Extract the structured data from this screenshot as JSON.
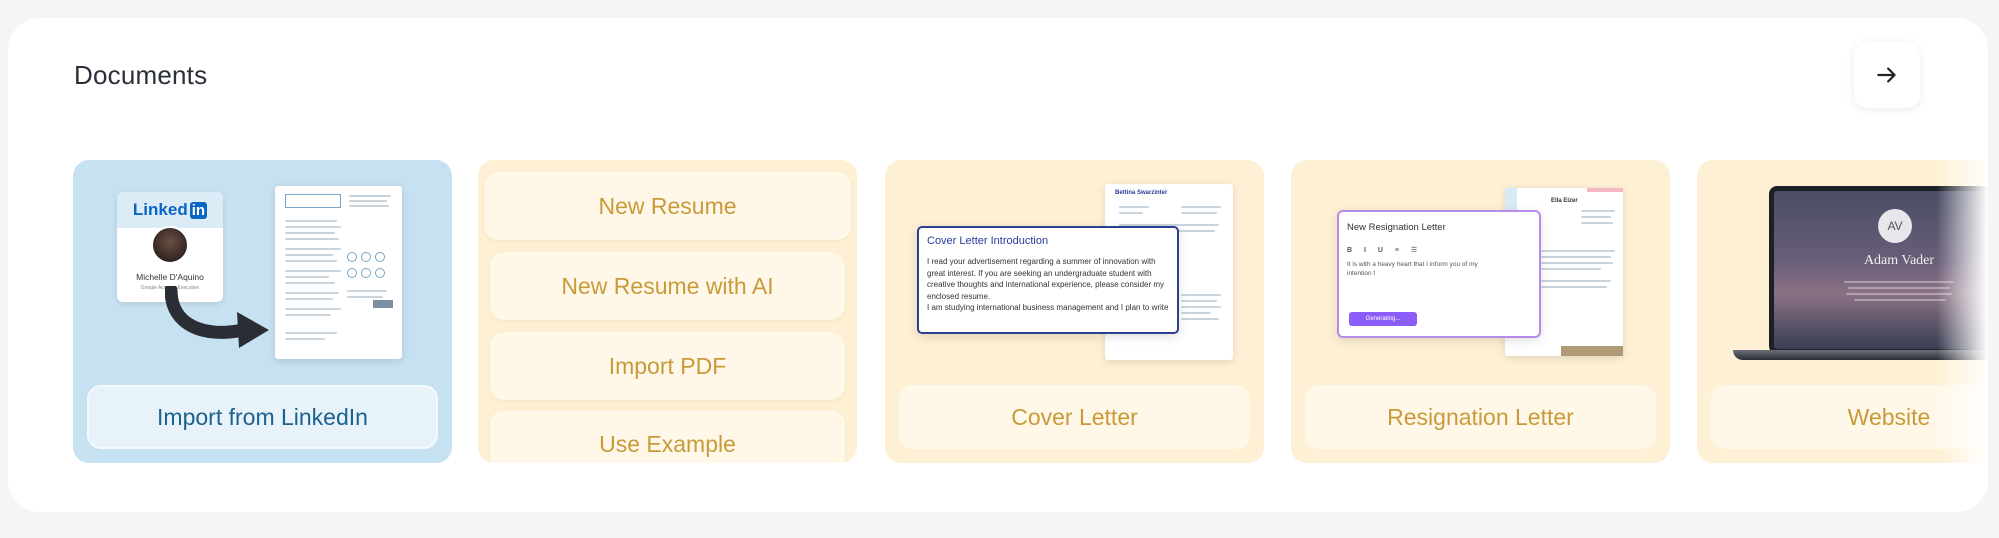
{
  "section": {
    "title": "Documents"
  },
  "cards": {
    "linkedin": {
      "label": "Import from LinkedIn",
      "badge_logo": "Linked",
      "badge_logo_in": "in",
      "profile_name": "Michelle D'Aquino",
      "profile_role": "Google Account Executive"
    },
    "resume_options": {
      "new_resume": "New Resume",
      "new_resume_ai": "New Resume with AI",
      "import_pdf": "Import PDF",
      "use_example": "Use Example"
    },
    "cover_letter": {
      "label": "Cover Letter",
      "doc_name": "Bettina Swarzinter",
      "editor_title": "Cover Letter Introduction",
      "editor_text": "I read your advertisement regarding a summer of innovation with great interest. If you are seeking an undergraduate student with creative thoughts and international experience, please consider my enclosed resume.",
      "editor_text_2": "I am studying international business management and I plan to write"
    },
    "resignation": {
      "label": "Resignation Letter",
      "doc_name": "Ella Eizer",
      "editor_title": "New Resignation Letter",
      "editor_text": "It is with a heavy heart that I inform you of my intention t",
      "generating": "Generating..."
    },
    "website": {
      "label": "Website",
      "initials": "AV",
      "name": "Adam Vader"
    }
  },
  "icons": {
    "next": "arrow-right-icon"
  },
  "colors": {
    "gold_text": "#c99a3a",
    "blue_text": "#1d6190",
    "card_blue": "#c6e1f1",
    "card_cream": "#fdf0d4"
  }
}
